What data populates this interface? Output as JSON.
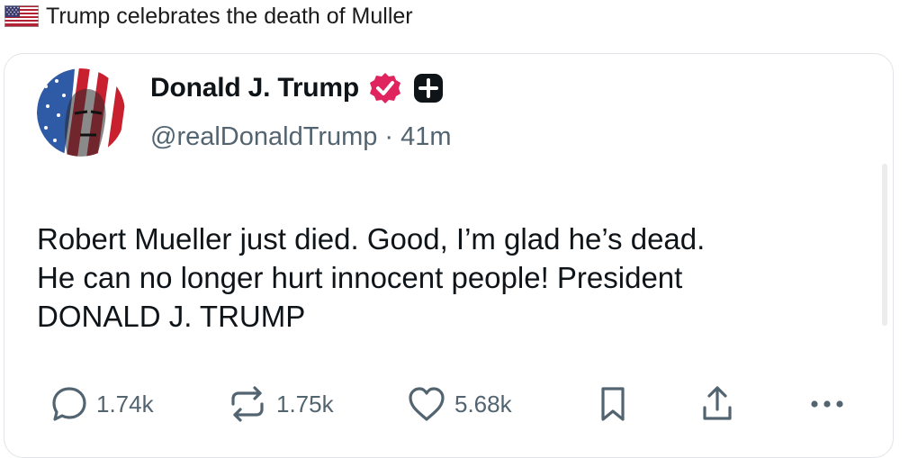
{
  "headline": {
    "flag_icon": "us-flag-icon",
    "text": "Trump celebrates the death of Muller"
  },
  "post": {
    "author": {
      "name": "Donald J. Trump",
      "handle": "@realDonaldTrump",
      "separator": "·",
      "time": "41m",
      "verified_icon": "verified-badge-icon",
      "verified_color": "#e0245e",
      "extra_icon": "plus-badge-icon"
    },
    "text": "Robert Mueller just died. Good, I’m glad he’s dead.\nHe can no longer hurt innocent people! President\nDONALD J. TRUMP",
    "actions": {
      "replies": "1.74k",
      "reposts": "1.75k",
      "likes": "5.68k",
      "bookmark_icon": "bookmark-icon",
      "share_icon": "share-icon",
      "more_icon": "more-icon"
    }
  },
  "colors": {
    "text_primary": "#0f1419",
    "text_secondary": "#536471",
    "card_border": "#e1e4e8"
  }
}
